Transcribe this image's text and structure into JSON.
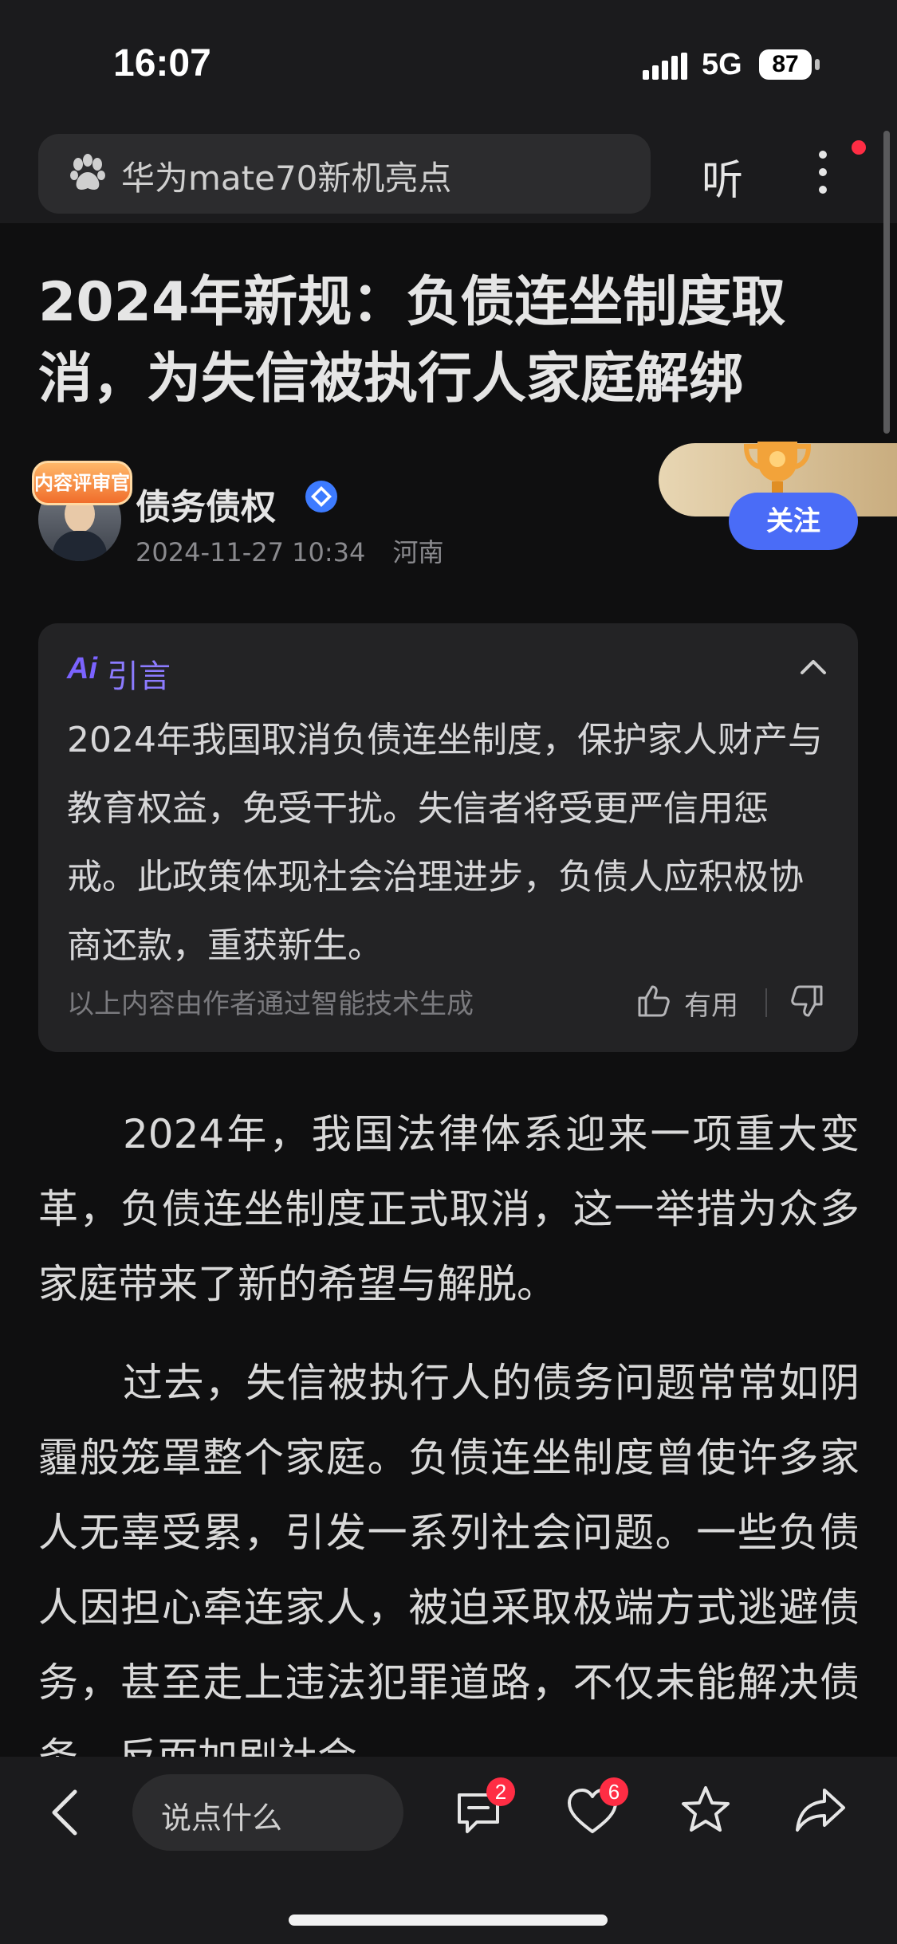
{
  "status_bar": {
    "time": "16:07",
    "network": "5G",
    "battery": "87"
  },
  "search": {
    "query": "华为mate70新机亮点",
    "listen_label": "听"
  },
  "article": {
    "title": "2024年新规：负债连坐制度取消，为失信被执行人家庭解绑",
    "author": {
      "badge": "内容评审官",
      "name": "债务债权",
      "datetime": "2024-11-27 10:34",
      "location": "河南"
    },
    "follow_label": "关注",
    "ai_summary": {
      "logo": "Ai",
      "label": "引言",
      "text": "2024年我国取消负债连坐制度，保护家人财产与教育权益，免受干扰。失信者将受更严信用惩戒。此政策体现社会治理进步，负债人应积极协商还款，重获新生。",
      "footer": "以上内容由作者通过智能技术生成",
      "useful_label": "有用"
    },
    "paragraphs": [
      "2024年，我国法律体系迎来一项重大变革，负债连坐制度正式取消，这一举措为众多家庭带来了新的希望与解脱。",
      "过去，失信被执行人的债务问题常常如阴霾般笼罩整个家庭。负债连坐制度曾使许多家人无辜受累，引发一系列社会问题。一些负债人因担心牵连家人，被迫采取极端方式逃避债务，甚至走上违法犯罪道路，不仅未能解决债务，反而加剧社会"
    ]
  },
  "bottom_bar": {
    "comment_placeholder": "说点什么",
    "comment_count": "2",
    "like_count": "6"
  },
  "colors": {
    "accent": "#4a6cf7",
    "ai_purple": "#7b63ff",
    "badge_red": "#ff2d44"
  }
}
